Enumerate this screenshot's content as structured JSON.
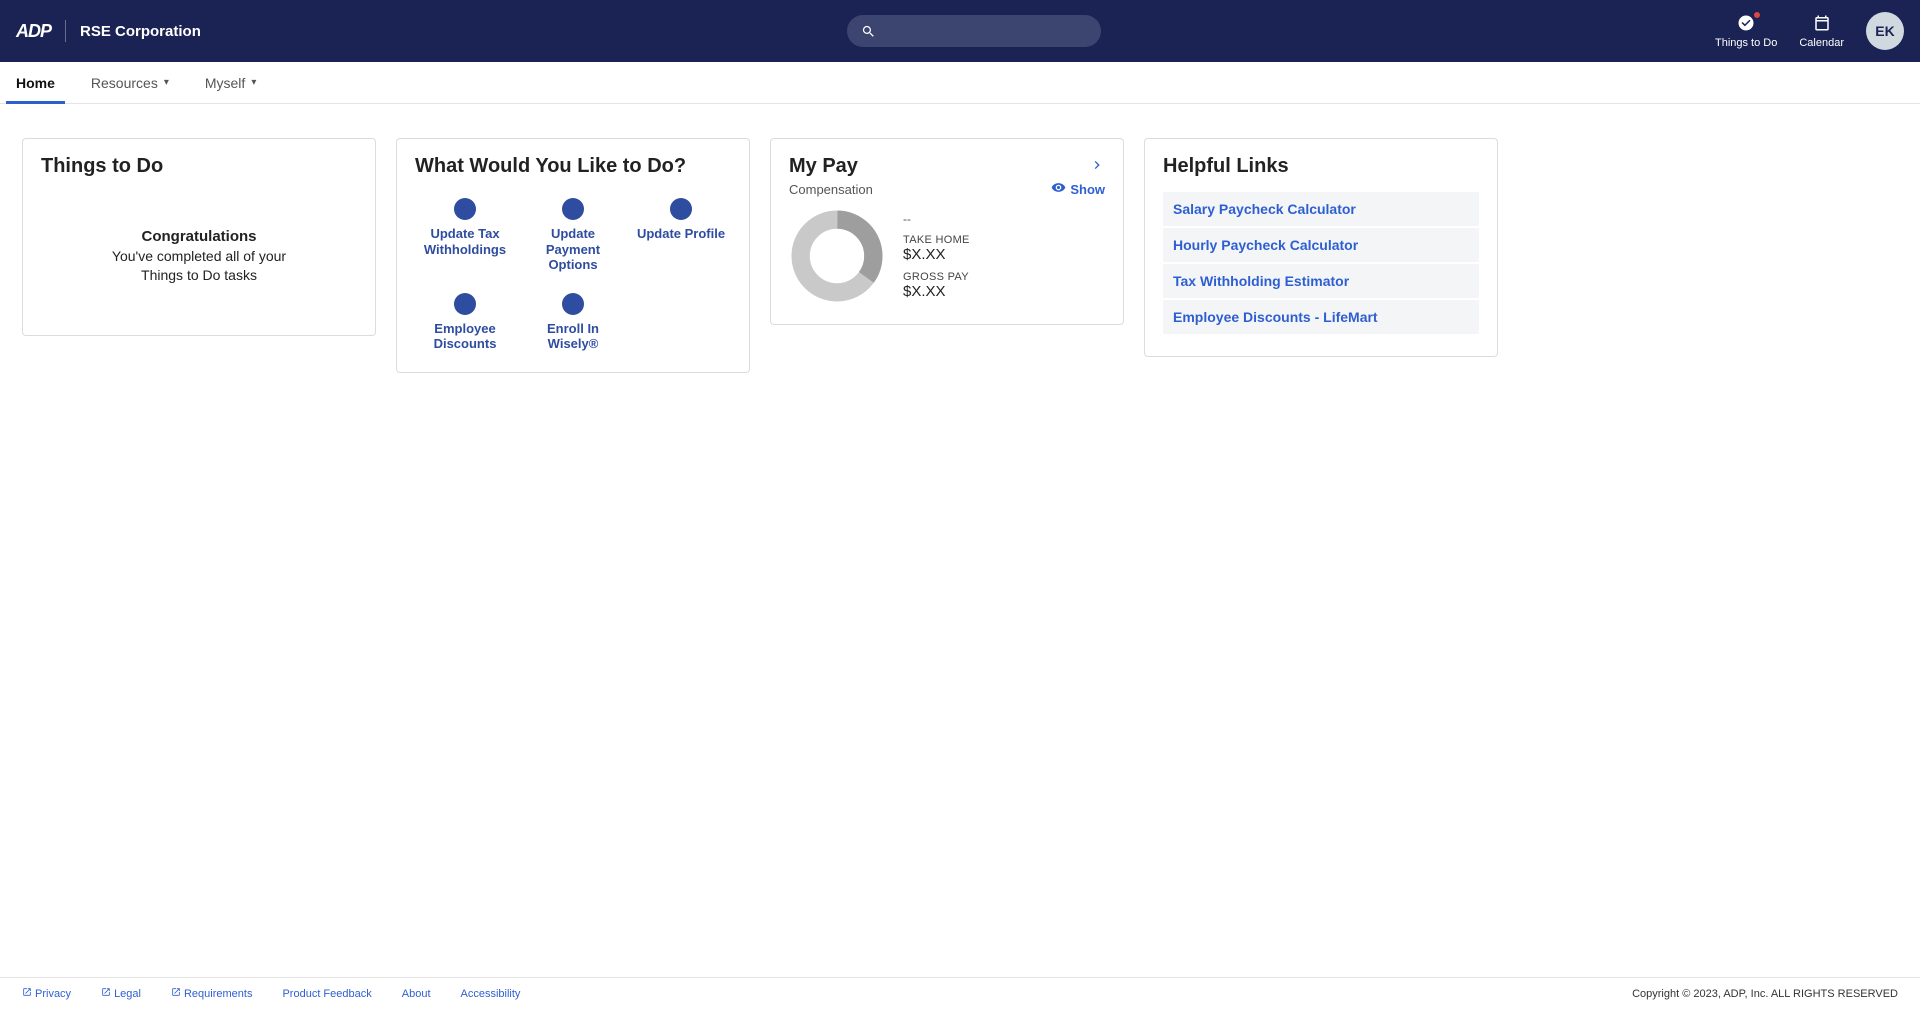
{
  "header": {
    "logo_text": "ADP",
    "company_name": "RSE Corporation",
    "search_placeholder": "",
    "things_to_do_label": "Things to Do",
    "calendar_label": "Calendar",
    "avatar_initials": "EK"
  },
  "nav": {
    "items": [
      {
        "label": "Home",
        "active": true,
        "dropdown": false
      },
      {
        "label": "Resources",
        "active": false,
        "dropdown": true
      },
      {
        "label": "Myself",
        "active": false,
        "dropdown": true
      }
    ]
  },
  "cards": {
    "things": {
      "title": "Things to Do",
      "congrats": "Congratulations",
      "message_line1": "You've completed all of your",
      "message_line2": "Things to Do tasks"
    },
    "actions": {
      "title": "What Would You Like to Do?",
      "items": [
        {
          "label": "Update Tax Withholdings"
        },
        {
          "label": "Update Payment Options"
        },
        {
          "label": "Update Profile"
        },
        {
          "label": "Employee Discounts"
        },
        {
          "label": "Enroll In Wisely®"
        }
      ]
    },
    "pay": {
      "title": "My Pay",
      "subtitle": "Compensation",
      "show_label": "Show",
      "date": "--",
      "take_home_label": "TAKE HOME",
      "take_home_value": "$X.XX",
      "gross_label": "GROSS PAY",
      "gross_value": "$X.XX"
    },
    "links": {
      "title": "Helpful Links",
      "items": [
        "Salary Paycheck Calculator",
        "Hourly Paycheck Calculator",
        "Tax Withholding Estimator",
        "Employee Discounts - LifeMart"
      ]
    }
  },
  "footer": {
    "links": [
      {
        "label": "Privacy",
        "external": true
      },
      {
        "label": "Legal",
        "external": true
      },
      {
        "label": "Requirements",
        "external": true
      },
      {
        "label": "Product Feedback",
        "external": false
      },
      {
        "label": "About",
        "external": false
      },
      {
        "label": "Accessibility",
        "external": false
      }
    ],
    "copyright": "Copyright © 2023, ADP, Inc. ALL RIGHTS RESERVED"
  }
}
